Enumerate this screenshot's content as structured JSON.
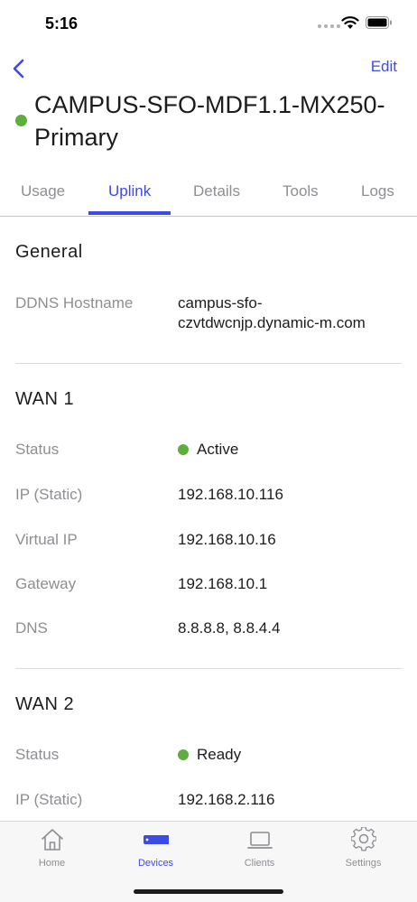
{
  "status_bar": {
    "time": "5:16"
  },
  "nav": {
    "edit_label": "Edit"
  },
  "device": {
    "title": "CAMPUS-SFO-MDF1.1-MX250-Primary",
    "status_color": "#5cae3d"
  },
  "tabs": [
    {
      "label": "Usage",
      "active": false
    },
    {
      "label": "Uplink",
      "active": true
    },
    {
      "label": "Details",
      "active": false
    },
    {
      "label": "Tools",
      "active": false
    },
    {
      "label": "Logs",
      "active": false
    }
  ],
  "general": {
    "title": "General",
    "ddns_label": "DDNS Hostname",
    "ddns_value_line1": "campus-sfo-",
    "ddns_value_line2": "czvtdwcnjp.dynamic-m.com"
  },
  "wan1": {
    "title": "WAN 1",
    "rows": [
      {
        "label": "Status",
        "value": "Active",
        "dot": true
      },
      {
        "label": "IP (Static)",
        "value": "192.168.10.116"
      },
      {
        "label": "Virtual IP",
        "value": "192.168.10.16"
      },
      {
        "label": "Gateway",
        "value": "192.168.10.1"
      },
      {
        "label": "DNS",
        "value": "8.8.8.8, 8.8.4.4"
      }
    ]
  },
  "wan2": {
    "title": "WAN 2",
    "rows": [
      {
        "label": "Status",
        "value": "Ready",
        "dot": true
      },
      {
        "label": "IP (Static)",
        "value": "192.168.2.116"
      }
    ]
  },
  "tab_bar": [
    {
      "label": "Home",
      "icon": "home-icon",
      "active": false
    },
    {
      "label": "Devices",
      "icon": "devices-icon",
      "active": true
    },
    {
      "label": "Clients",
      "icon": "laptop-icon",
      "active": false
    },
    {
      "label": "Settings",
      "icon": "gear-icon",
      "active": false
    }
  ],
  "colors": {
    "accent": "#3c4be8",
    "status_green": "#5cae3d",
    "muted": "#8e8e93"
  }
}
